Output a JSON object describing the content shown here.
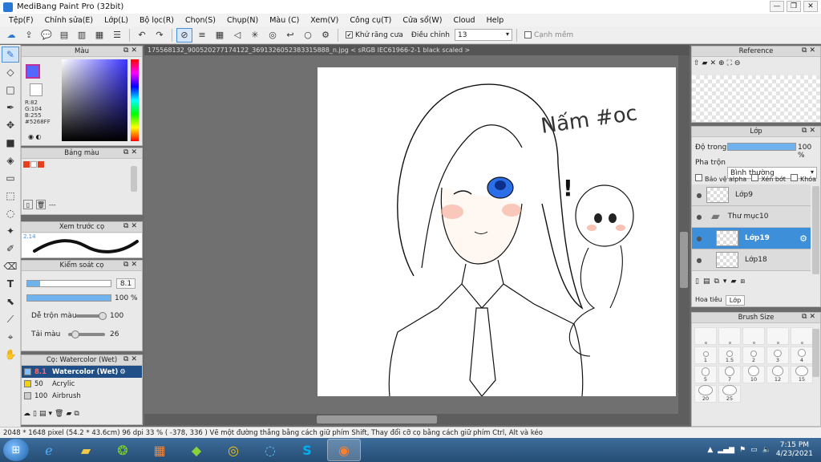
{
  "window": {
    "title": "MediBang Paint Pro (32bit)",
    "minimize": "—",
    "restore": "❐",
    "close": "✕"
  },
  "menu": [
    "Tệp(F)",
    "Chỉnh sửa(E)",
    "Lớp(L)",
    "Bộ lọc(R)",
    "Chọn(S)",
    "Chụp(N)",
    "Màu (C)",
    "Xem(V)",
    "Công cụ(T)",
    "Cửa sổ(W)",
    "Cloud",
    "Help"
  ],
  "toolbar": {
    "antialias_label": "Khử răng cưa",
    "adjust_label": "Điều chỉnh",
    "adjust_value": "13",
    "smooth_label": "Cạnh mềm"
  },
  "color_panel": {
    "title": "Màu",
    "r": "R:82",
    "g": "G:104",
    "b": "B:255",
    "hex": "#5268FF",
    "fg_color": "#5268FF",
    "bg_color": "#ffffff"
  },
  "palette_panel": {
    "title": "Bảng màu",
    "footer": "---",
    "colors": [
      "#e8401c",
      "#ffffff",
      "#e8401c"
    ]
  },
  "brush_preview": {
    "title": "Xem trước cọ",
    "size": "2.14"
  },
  "brush_control": {
    "title": "Kiểm soát cọ",
    "size_value": "8.1",
    "opacity_value": "100 %",
    "mix_label": "Dễ trộn màu",
    "mix_value": "100",
    "flow_label": "Tải màu",
    "flow_value": "26"
  },
  "brush_list": {
    "title": "Cọ: Watercolor (Wet)",
    "items": [
      {
        "size": "8.1",
        "name": "Watercolor (Wet)",
        "swatch": "#7ec0ff",
        "selected": true
      },
      {
        "size": "50",
        "name": "Acrylic",
        "swatch": "#f2d200",
        "selected": false
      },
      {
        "size": "100",
        "name": "Airbrush",
        "swatch": "#cccccc",
        "selected": false
      }
    ]
  },
  "document": {
    "tab": "175568132_900520277174122_3691326052383315888_n.jpg < sRGB IEC61966-2-1 black scaled >",
    "handwriting": "Nấm #oc",
    "exclaim": "!"
  },
  "reference_panel": {
    "title": "Reference"
  },
  "layer_panel": {
    "title": "Lớp",
    "opacity_label": "Độ trong",
    "opacity_value": "100 %",
    "opacity_fraction": 1.0,
    "blend_label": "Pha trộn",
    "blend_value": "Bình thường",
    "protect_alpha": "Bảo vệ alpha",
    "clipping": "Xén bớt",
    "lock": "Khóa",
    "layers": [
      {
        "name": "Lớp9",
        "indent": false,
        "folder": false,
        "selected": false
      },
      {
        "name": "Thư mục10",
        "indent": false,
        "folder": true,
        "selected": false
      },
      {
        "name": "Lớp19",
        "indent": true,
        "folder": false,
        "selected": true
      },
      {
        "name": "Lớp18",
        "indent": true,
        "folder": false,
        "selected": false
      }
    ],
    "tabs": [
      "Hoa tiêu",
      "Lớp"
    ]
  },
  "brush_size_panel": {
    "title": "Brush Size",
    "sizes": [
      "1",
      "1.5",
      "2",
      "3",
      "4",
      "5",
      "7",
      "10",
      "12",
      "15",
      "20",
      "25"
    ]
  },
  "status": {
    "text": "2048 * 1648 pixel  (54.2 * 43.6cm)  96 dpi  33 %  ( -378, 336 )  Vẽ một đường thẳng bằng cách giữ phím Shift, Thay đổi cỡ cọ bằng cách giữ phím Ctrl, Alt và kéo"
  },
  "taskbar": {
    "time": "7:15 PM",
    "date": "4/23/2021"
  }
}
